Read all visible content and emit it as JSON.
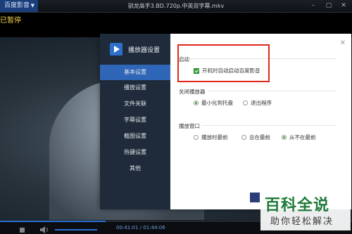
{
  "titlebar": {
    "app_menu_label": "百度影音",
    "window_title": "驯龙高手3.BD.720p.中英双字幕.mkv"
  },
  "player": {
    "pause_text": "已暂停",
    "time_text": "00:41:01 / 01:44:06",
    "progress_fraction": 0.3
  },
  "dialog": {
    "title": "播放器设置",
    "nav": [
      {
        "label": "基本设置",
        "active": true
      },
      {
        "label": "播放设置"
      },
      {
        "label": "文件关联"
      },
      {
        "label": "字幕设置"
      },
      {
        "label": "截图设置"
      },
      {
        "label": "热键设置"
      },
      {
        "label": "其他"
      }
    ],
    "sections": {
      "startup": {
        "title": "启动",
        "option": "开机时自动启动百度影音",
        "checked": true
      },
      "close": {
        "title": "关闭播放器",
        "options": [
          "最小化到托盘",
          "退出程序"
        ],
        "selected": 0
      },
      "window": {
        "title": "播放窗口",
        "options": [
          "播放时最前",
          "总在最前",
          "从不在最前"
        ],
        "selected": 2
      }
    }
  },
  "watermark": {
    "big": "百科全说",
    "small": "助你轻松解决"
  },
  "colors": {
    "accent": "#2f66b8",
    "sidebar": "#1f2b3a",
    "annotation": "#e0261d",
    "check": "#37a33a"
  }
}
